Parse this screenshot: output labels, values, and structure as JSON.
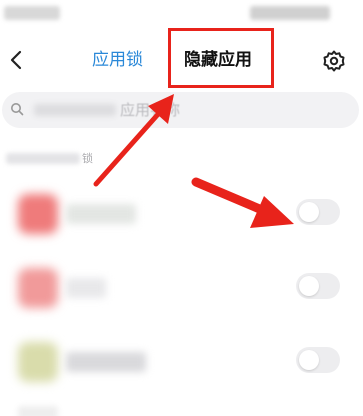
{
  "header": {
    "tabs": [
      {
        "label": "应用锁",
        "active": false
      },
      {
        "label": "隐藏应用",
        "active": true
      }
    ]
  },
  "search": {
    "placeholder_visible": "应用名称"
  },
  "section": {
    "title": "锁"
  },
  "apps": [
    {
      "icon_color": "#ef7b7b",
      "toggle_on": false
    },
    {
      "icon_color": "#f19a9a",
      "toggle_on": false
    },
    {
      "icon_color": "#d9dcab",
      "toggle_on": false
    }
  ],
  "annotation": {
    "box_color": "#e8231b",
    "arrow_color": "#e8231b"
  },
  "colors": {
    "accent": "#2a88d8",
    "toggle_off": "#ededef"
  }
}
